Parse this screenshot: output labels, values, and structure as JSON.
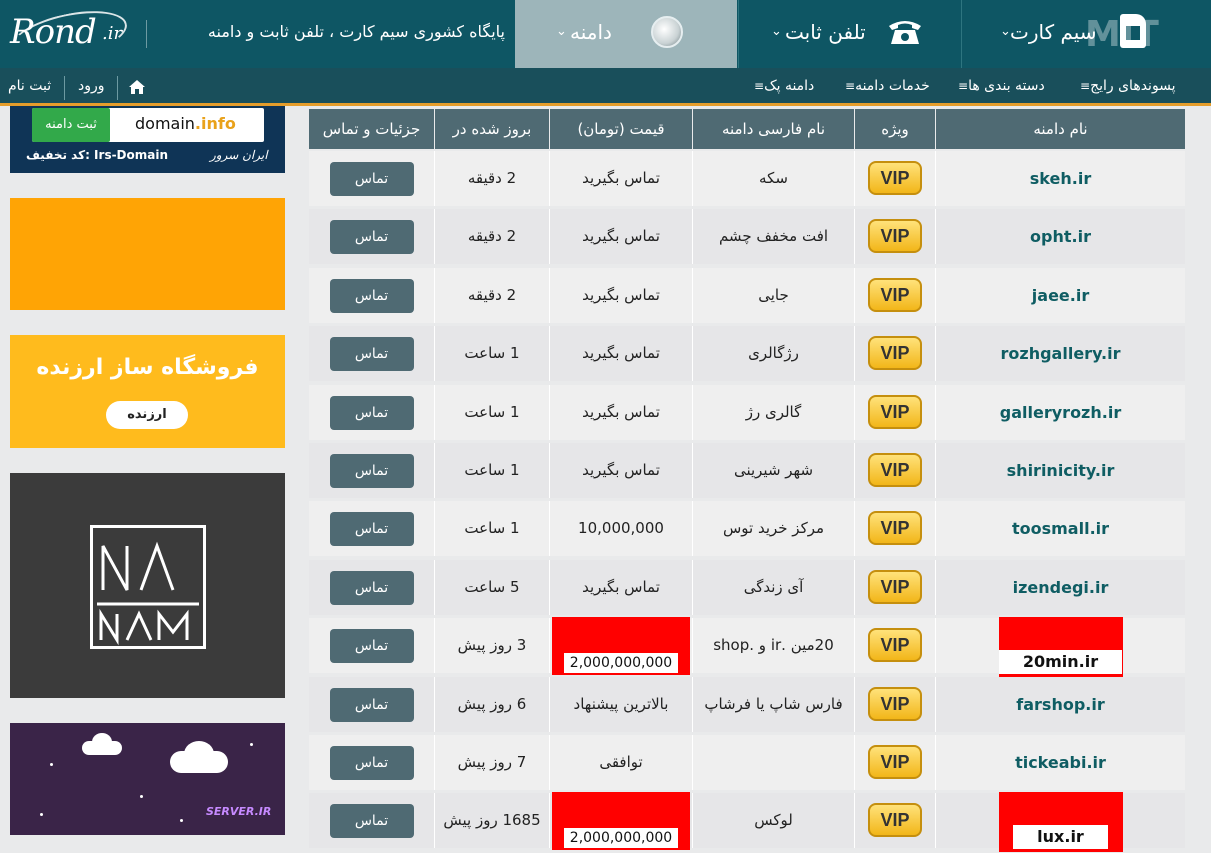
{
  "header": {
    "logo": "Rond",
    "logo_suffix": ".ir",
    "site_description": "پایگاه کشوری سیم کارت ، تلفن ثابت و دامنه",
    "tabs": [
      {
        "label": "دامنه",
        "icon": "globe-icon"
      },
      {
        "label": "تلفن ثابت",
        "icon": "telephone-icon"
      },
      {
        "label": "سیم کارت",
        "icon": "sim-card-icon"
      }
    ]
  },
  "subnav": {
    "items": [
      "پسوندهای رایج",
      "دسته بندی ها",
      "خدمات دامنه",
      "دامنه پک"
    ],
    "login": "ورود",
    "register": "ثبت نام"
  },
  "ads": {
    "ad1": {
      "button": "ثبت دامنه",
      "domain_main": "domain",
      "domain_ext": ".info",
      "code": "کد تخفیف: Irs-Domain",
      "brand": "ایران سرور"
    },
    "ad3": {
      "title": "فروشگاه ساز ارزنده",
      "button": "ارزنده"
    },
    "ad4": {
      "brand_line1": "NA",
      "brand_line2": "NAM"
    },
    "ad5": {
      "text": "SERVER.IR"
    }
  },
  "table": {
    "headers": {
      "domain": "نام دامنه",
      "special": "ویژه",
      "persian": "نام فارسی دامنه",
      "price": "قیمت (تومان)",
      "updated": "بروز شده در",
      "details": "جزئیات و تماس"
    },
    "rows": [
      {
        "domain": "skeh.ir",
        "vip": "VIP",
        "persian": "سکه",
        "price": "تماس بگیرید",
        "updated": "2 دقیقه",
        "action": "تماس"
      },
      {
        "domain": "opht.ir",
        "vip": "VIP",
        "persian": "افت مخفف چشم",
        "price": "تماس بگیرید",
        "updated": "2 دقیقه",
        "action": "تماس"
      },
      {
        "domain": "jaee.ir",
        "vip": "VIP",
        "persian": "جایی",
        "price": "تماس بگیرید",
        "updated": "2 دقیقه",
        "action": "تماس"
      },
      {
        "domain": "rozhgallery.ir",
        "vip": "VIP",
        "persian": "رژگالری",
        "price": "تماس بگیرید",
        "updated": "1 ساعت",
        "action": "تماس"
      },
      {
        "domain": "galleryrozh.ir",
        "vip": "VIP",
        "persian": "گالری رژ",
        "price": "تماس بگیرید",
        "updated": "1 ساعت",
        "action": "تماس"
      },
      {
        "domain": "shirinicity.ir",
        "vip": "VIP",
        "persian": "شهر شیرینی",
        "price": "تماس بگیرید",
        "updated": "1 ساعت",
        "action": "تماس"
      },
      {
        "domain": "toosmall.ir",
        "vip": "VIP",
        "persian": "مرکز خرید توس",
        "price": "10,000,000",
        "updated": "1 ساعت",
        "action": "تماس"
      },
      {
        "domain": "izendegi.ir",
        "vip": "VIP",
        "persian": "آی زندگی",
        "price": "تماس بگیرید",
        "updated": "5 ساعت",
        "action": "تماس"
      },
      {
        "domain": "20min.ir",
        "vip": "VIP",
        "persian": "20مین .ir و .shop",
        "price": "2,000,000,000",
        "updated": "3 روز پیش",
        "action": "تماس",
        "highlight": true
      },
      {
        "domain": "farshop.ir",
        "vip": "VIP",
        "persian": "فارس شاپ یا فرشاپ",
        "price": "بالاترین پیشنهاد",
        "updated": "6 روز پیش",
        "action": "تماس"
      },
      {
        "domain": "tickeabi.ir",
        "vip": "VIP",
        "persian": "",
        "price": "توافقی",
        "updated": "7 روز پیش",
        "action": "تماس"
      },
      {
        "domain": "lux.ir",
        "vip": "VIP",
        "persian": "لوکس",
        "price": "2,000,000,000",
        "updated": "1685 روز پیش",
        "action": "تماس",
        "highlight": true
      }
    ]
  },
  "colors": {
    "topbar": "#0e5664",
    "accent": "#e59d2b",
    "header_cell": "#4f6a73",
    "domain_text": "#0f5d63",
    "highlight": "#ff0000"
  }
}
